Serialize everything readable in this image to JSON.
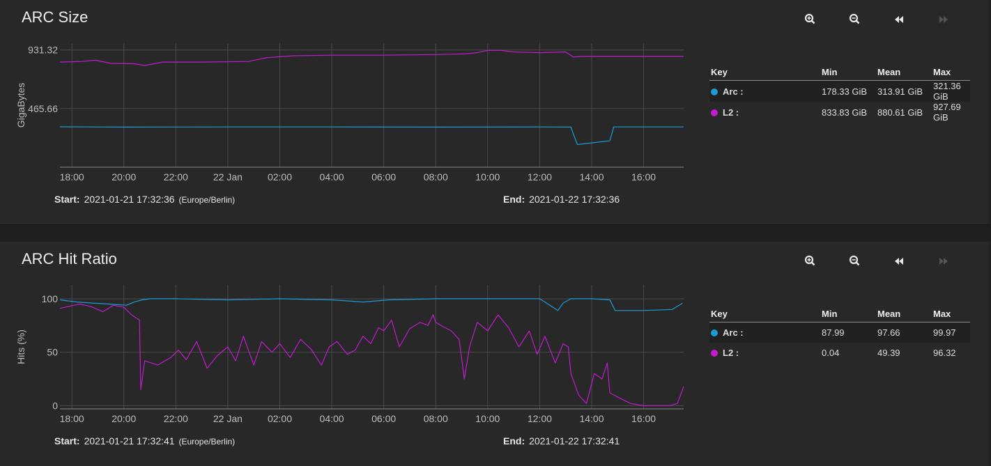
{
  "colors": {
    "arc": "#1e9ad6",
    "l2": "#c21bd0"
  },
  "toolbar": {
    "zoom_in": "zoom-in-icon",
    "zoom_out": "zoom-out-icon",
    "back": "rewind-icon",
    "forward": "fast-forward-icon"
  },
  "charts": [
    {
      "title": "ARC Size",
      "footer": {
        "start_label": "Start:",
        "start_value": "2021-01-21 17:32:36",
        "timezone": "(Europe/Berlin)",
        "end_label": "End:",
        "end_value": "2021-01-22 17:32:36"
      },
      "legend": {
        "headers": [
          "Key",
          "Min",
          "Mean",
          "Max"
        ],
        "rows": [
          {
            "name": "Arc :",
            "min": "178.33 GiB",
            "mean": "313.91 GiB",
            "max": "321.36 GiB"
          },
          {
            "name": "L2 :",
            "min": "833.83 GiB",
            "mean": "880.61 GiB",
            "max": "927.69 GiB"
          }
        ]
      }
    },
    {
      "title": "ARC Hit Ratio",
      "footer": {
        "start_label": "Start:",
        "start_value": "2021-01-21 17:32:41",
        "timezone": "(Europe/Berlin)",
        "end_label": "End:",
        "end_value": "2021-01-22 17:32:41"
      },
      "legend": {
        "headers": [
          "Key",
          "Min",
          "Mean",
          "Max"
        ],
        "rows": [
          {
            "name": "Arc :",
            "min": "87.99",
            "mean": "97.66",
            "max": "99.97"
          },
          {
            "name": "L2 :",
            "min": "0.04",
            "mean": "49.39",
            "max": "96.32"
          }
        ]
      }
    }
  ],
  "chart_data": [
    {
      "type": "line",
      "title": "ARC Size",
      "ylabel": "GigaBytes",
      "xlabel": "",
      "x_tick_labels": [
        "18:00",
        "20:00",
        "22:00",
        "22 Jan",
        "02:00",
        "04:00",
        "06:00",
        "08:00",
        "10:00",
        "12:00",
        "14:00",
        "16:00"
      ],
      "y_tick_labels": [
        "465.66",
        "931.32"
      ],
      "y_ticks": [
        465.66,
        931.32
      ],
      "xlim_hours": [
        17.54,
        41.54
      ],
      "x_ticks_hours": [
        18,
        20,
        22,
        24,
        26,
        28,
        30,
        32,
        34,
        36,
        38,
        40
      ],
      "ylim": [
        0,
        985
      ],
      "grid": true,
      "series": [
        {
          "name": "Arc",
          "color_key": "arc",
          "x": [
            17.54,
            20,
            24,
            28,
            32,
            36,
            37.2,
            37.3,
            37.45,
            38.7,
            38.85,
            41.54
          ],
          "y": [
            321,
            319,
            320,
            320,
            319,
            320,
            319,
            260,
            180,
            210,
            320,
            320
          ]
        },
        {
          "name": "L2",
          "color_key": "l2",
          "x": [
            17.54,
            18.4,
            18.9,
            19.5,
            20.4,
            20.8,
            21.5,
            23,
            24.8,
            25.5,
            26.5,
            28,
            30,
            32,
            33.1,
            33.6,
            34,
            34.5,
            35,
            36,
            37,
            37.3,
            37.6,
            41.54
          ],
          "y": [
            835,
            840,
            850,
            825,
            822,
            808,
            835,
            835,
            840,
            870,
            885,
            890,
            890,
            895,
            900,
            910,
            928,
            928,
            915,
            910,
            915,
            875,
            880,
            880
          ]
        }
      ]
    },
    {
      "type": "line",
      "title": "ARC Hit Ratio",
      "ylabel": "Hits (%)",
      "xlabel": "",
      "x_tick_labels": [
        "18:00",
        "20:00",
        "22:00",
        "22 Jan",
        "02:00",
        "04:00",
        "06:00",
        "08:00",
        "10:00",
        "12:00",
        "14:00",
        "16:00"
      ],
      "y_tick_labels": [
        "0",
        "50",
        "100"
      ],
      "y_ticks": [
        0,
        50,
        100
      ],
      "xlim_hours": [
        17.54,
        41.54
      ],
      "x_ticks_hours": [
        18,
        20,
        22,
        24,
        26,
        28,
        30,
        32,
        34,
        36,
        38,
        40
      ],
      "ylim": [
        -3,
        113
      ],
      "grid": true,
      "series": [
        {
          "name": "Arc",
          "color_key": "arc",
          "x": [
            17.54,
            18.2,
            18.8,
            19.5,
            20.1,
            20.4,
            20.7,
            21,
            22,
            24,
            26,
            28,
            29.2,
            30.2,
            32,
            34,
            36,
            36.2,
            36.7,
            36.9,
            37.2,
            38,
            38.7,
            38.9,
            40,
            41.1,
            41.5
          ],
          "y": [
            99,
            97,
            96,
            95,
            94,
            97,
            99,
            100,
            100,
            99,
            100,
            99,
            97,
            99,
            100,
            100,
            100,
            97,
            89,
            96,
            100,
            100,
            99,
            89,
            89,
            90,
            96
          ]
        },
        {
          "name": "L2",
          "color_key": "l2",
          "x": [
            17.54,
            17.9,
            18.3,
            18.7,
            19.2,
            19.6,
            20.0,
            20.3,
            20.6,
            20.65,
            20.8,
            21.3,
            21.8,
            22.1,
            22.4,
            22.8,
            23.2,
            23.6,
            24.0,
            24.3,
            24.6,
            25.0,
            25.3,
            25.7,
            26.0,
            26.4,
            26.8,
            27.2,
            27.6,
            27.9,
            28.2,
            28.6,
            28.9,
            29.2,
            29.5,
            29.8,
            30.0,
            30.3,
            30.6,
            31.0,
            31.4,
            31.7,
            31.9,
            32.0,
            32.2,
            32.6,
            32.9,
            33.1,
            33.3,
            33.6,
            34.0,
            34.4,
            34.8,
            35.2,
            35.6,
            35.9,
            36.2,
            36.6,
            36.9,
            37.1,
            37.2,
            37.5,
            37.8,
            38.1,
            38.4,
            38.6,
            38.7,
            39.0,
            39.5,
            40.0,
            40.5,
            41.0,
            41.3,
            41.54
          ],
          "y": [
            91,
            93,
            95,
            93,
            88,
            94,
            92,
            85,
            80,
            15,
            42,
            38,
            45,
            52,
            43,
            60,
            35,
            47,
            55,
            42,
            65,
            38,
            60,
            50,
            58,
            45,
            62,
            53,
            38,
            55,
            60,
            48,
            52,
            65,
            58,
            73,
            70,
            80,
            55,
            72,
            78,
            75,
            85,
            78,
            75,
            70,
            62,
            25,
            55,
            78,
            70,
            85,
            73,
            55,
            70,
            48,
            65,
            40,
            58,
            55,
            30,
            10,
            2,
            30,
            25,
            40,
            12,
            8,
            2,
            0,
            0,
            0,
            2,
            18
          ]
        }
      ]
    }
  ]
}
